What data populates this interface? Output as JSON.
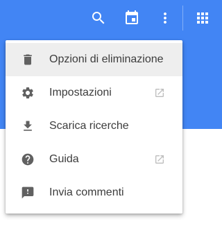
{
  "toolbar": {
    "search_icon": "search-icon",
    "calendar_icon": "calendar-icon",
    "more_icon": "more-vert-icon",
    "apps_icon": "apps-grid-icon"
  },
  "menu": {
    "items": [
      {
        "label": "Opzioni di eliminazione",
        "icon": "trash-icon",
        "highlighted": true,
        "external": false
      },
      {
        "label": "Impostazioni",
        "icon": "gear-icon",
        "highlighted": false,
        "external": true
      },
      {
        "label": "Scarica ricerche",
        "icon": "download-icon",
        "highlighted": false,
        "external": false
      },
      {
        "label": "Guida",
        "icon": "help-icon",
        "highlighted": false,
        "external": true
      },
      {
        "label": "Invia commenti",
        "icon": "feedback-icon",
        "highlighted": false,
        "external": false
      }
    ]
  },
  "colors": {
    "app_bar": "#4285f4",
    "menu_highlight": "#eeeeee",
    "icon_gray": "#616161",
    "text": "#3c3c3c"
  }
}
